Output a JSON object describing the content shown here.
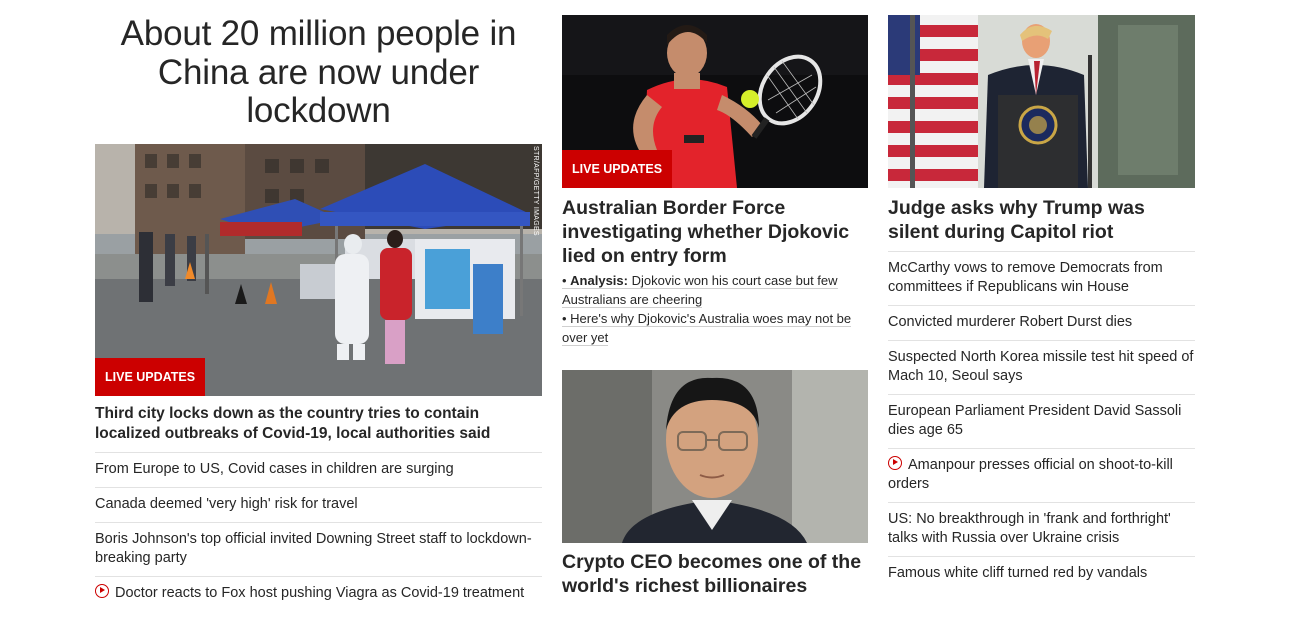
{
  "colors": {
    "accent": "#cc0000",
    "text": "#262626",
    "divider": "#e2e2e2"
  },
  "left": {
    "headline": "About 20 million people in China are now under lockdown",
    "image": {
      "credit": "STR/AFP/GETTY IMAGES",
      "badge": "LIVE UPDATES"
    },
    "story": "Third city locks down as the country tries to contain localized outbreaks of Covid-19, local authorities said",
    "links": [
      {
        "text": "From Europe to US, Covid cases in children are surging"
      },
      {
        "text": "Canada deemed 'very high' risk for travel"
      },
      {
        "text": "Boris Johnson's top official invited Downing Street staff to lockdown-breaking party"
      },
      {
        "text": "Doctor reacts to Fox host pushing Viagra as Covid-19 treatment",
        "icon": "play-icon"
      }
    ]
  },
  "middle": {
    "story1": {
      "badge": "LIVE UPDATES",
      "headline": "Australian Border Force investigating whether Djokovic lied on entry form",
      "analysis_label": "Analysis:",
      "analysis_text": "Djokovic won his court case but few Australians are cheering",
      "link2": "Here's why Djokovic's Australia woes may not be over yet"
    },
    "story2": {
      "headline": "Crypto CEO becomes one of the world's richest billionaires"
    }
  },
  "right": {
    "headline": "Judge asks why Trump was silent during Capitol riot",
    "links": [
      {
        "text": "McCarthy vows to remove Democrats from committees if Republicans win House"
      },
      {
        "text": "Convicted murderer Robert Durst dies"
      },
      {
        "text": "Suspected North Korea missile test hit speed of Mach 10, Seoul says"
      },
      {
        "text": "European Parliament President David Sassoli dies age 65"
      },
      {
        "text": "Amanpour presses official on shoot-to-kill orders",
        "icon": "play-icon"
      },
      {
        "text": "US: No breakthrough in 'frank and forthright' talks with Russia over Ukraine crisis"
      },
      {
        "text": "Famous white cliff turned red by vandals"
      }
    ]
  }
}
